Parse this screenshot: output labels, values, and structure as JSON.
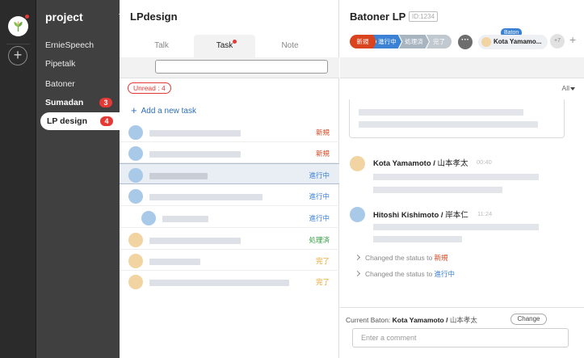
{
  "rail": {
    "logo": "leaf-logo-icon",
    "add": "+"
  },
  "sidebar": {
    "title": "project",
    "items": [
      {
        "label": "ErnieSpeech"
      },
      {
        "label": "Pipetalk"
      },
      {
        "label": "Batoner"
      },
      {
        "label": "Sumadan",
        "badge": "3"
      },
      {
        "label": "LP design",
        "badge": "4"
      }
    ]
  },
  "middle": {
    "title": "LPdesign",
    "tabs": [
      {
        "label": "Talk"
      },
      {
        "label": "Task"
      },
      {
        "label": "Note"
      }
    ],
    "unread": "Unread : 4",
    "add_task": "Add a new task",
    "tasks": [
      {
        "status": "新規",
        "status_color": "#d9431e"
      },
      {
        "status": "新規",
        "status_color": "#d9431e"
      },
      {
        "status": "進行中",
        "status_color": "#3b82d4"
      },
      {
        "status": "進行中",
        "status_color": "#3b82d4"
      },
      {
        "status": "進行中",
        "status_color": "#3b82d4"
      },
      {
        "status": "処理済",
        "status_color": "#2e9d3e"
      },
      {
        "status": "完了",
        "status_color": "#e8a126"
      },
      {
        "status": "完了",
        "status_color": "#e8a126"
      }
    ]
  },
  "right": {
    "title": "Batoner LP",
    "id": "ID:1234",
    "statuses": [
      "新規",
      "進行中",
      "処理済",
      "完了"
    ],
    "more": "···",
    "baton_tag": "Baton",
    "baton_name": "Kota Yamamo...",
    "more_members": "+7",
    "add_member": "+",
    "filter": "All",
    "messages": [
      {
        "name": "Kota Yamamoto /",
        "jp": "山本孝太",
        "time": "00:40"
      },
      {
        "name": "Hitoshi Kishimoto /",
        "jp": "岸本仁",
        "time": "11:24"
      }
    ],
    "system": [
      {
        "text": "Changed the status to",
        "status": "新規"
      },
      {
        "text": "Changed the status to",
        "status": "進行中"
      }
    ],
    "footer": {
      "label": "Current Baton:",
      "name": "Kota Yamamoto /",
      "jp": "山本孝太",
      "change": "Change",
      "comment_placeholder": "Enter a comment"
    }
  },
  "colors": {
    "new": "#d9431e",
    "in_progress": "#3b82d4",
    "processed": "#2e9d3e",
    "done": "#e8a126",
    "badge": "#e53935"
  }
}
